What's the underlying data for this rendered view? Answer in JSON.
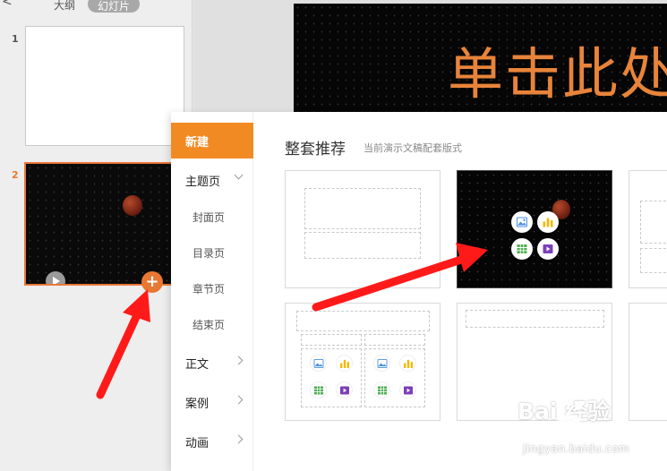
{
  "left_panel": {
    "back_symbol": "<",
    "tab_outline": "大纲",
    "tab_slides": "幻灯片",
    "slides": [
      {
        "number": "1"
      },
      {
        "number": "2"
      }
    ],
    "add_symbol": "+"
  },
  "editor": {
    "slide_title": "单击此处"
  },
  "popup": {
    "menu": [
      {
        "label": "新建",
        "active": true
      },
      {
        "label": "主题页",
        "chevron": "down"
      },
      {
        "label": "封面页"
      },
      {
        "label": "目录页"
      },
      {
        "label": "章节页"
      },
      {
        "label": "结束页"
      },
      {
        "label": "正文",
        "chevron": "right"
      },
      {
        "label": "案例",
        "chevron": "right"
      },
      {
        "label": "动画",
        "chevron": "right"
      }
    ],
    "section_title": "整套推荐",
    "section_subtitle": "当前演示文稿配套版式"
  },
  "watermark": {
    "logo": "Bai 经验",
    "url": "jingyan.baidu.com"
  },
  "colors": {
    "accent": "#f28a23",
    "arrow": "#ff1a1a",
    "slide_title": "#e8843a",
    "placeholder_picture": "#4a90e2",
    "placeholder_chart": "#f5b800",
    "placeholder_table": "#4caf50",
    "placeholder_media": "#7b3fb8"
  },
  "icons": [
    "picture-icon",
    "chart-icon",
    "table-icon",
    "media-icon",
    "play-icon",
    "add-icon",
    "chevron-down-icon",
    "chevron-right-icon"
  ]
}
